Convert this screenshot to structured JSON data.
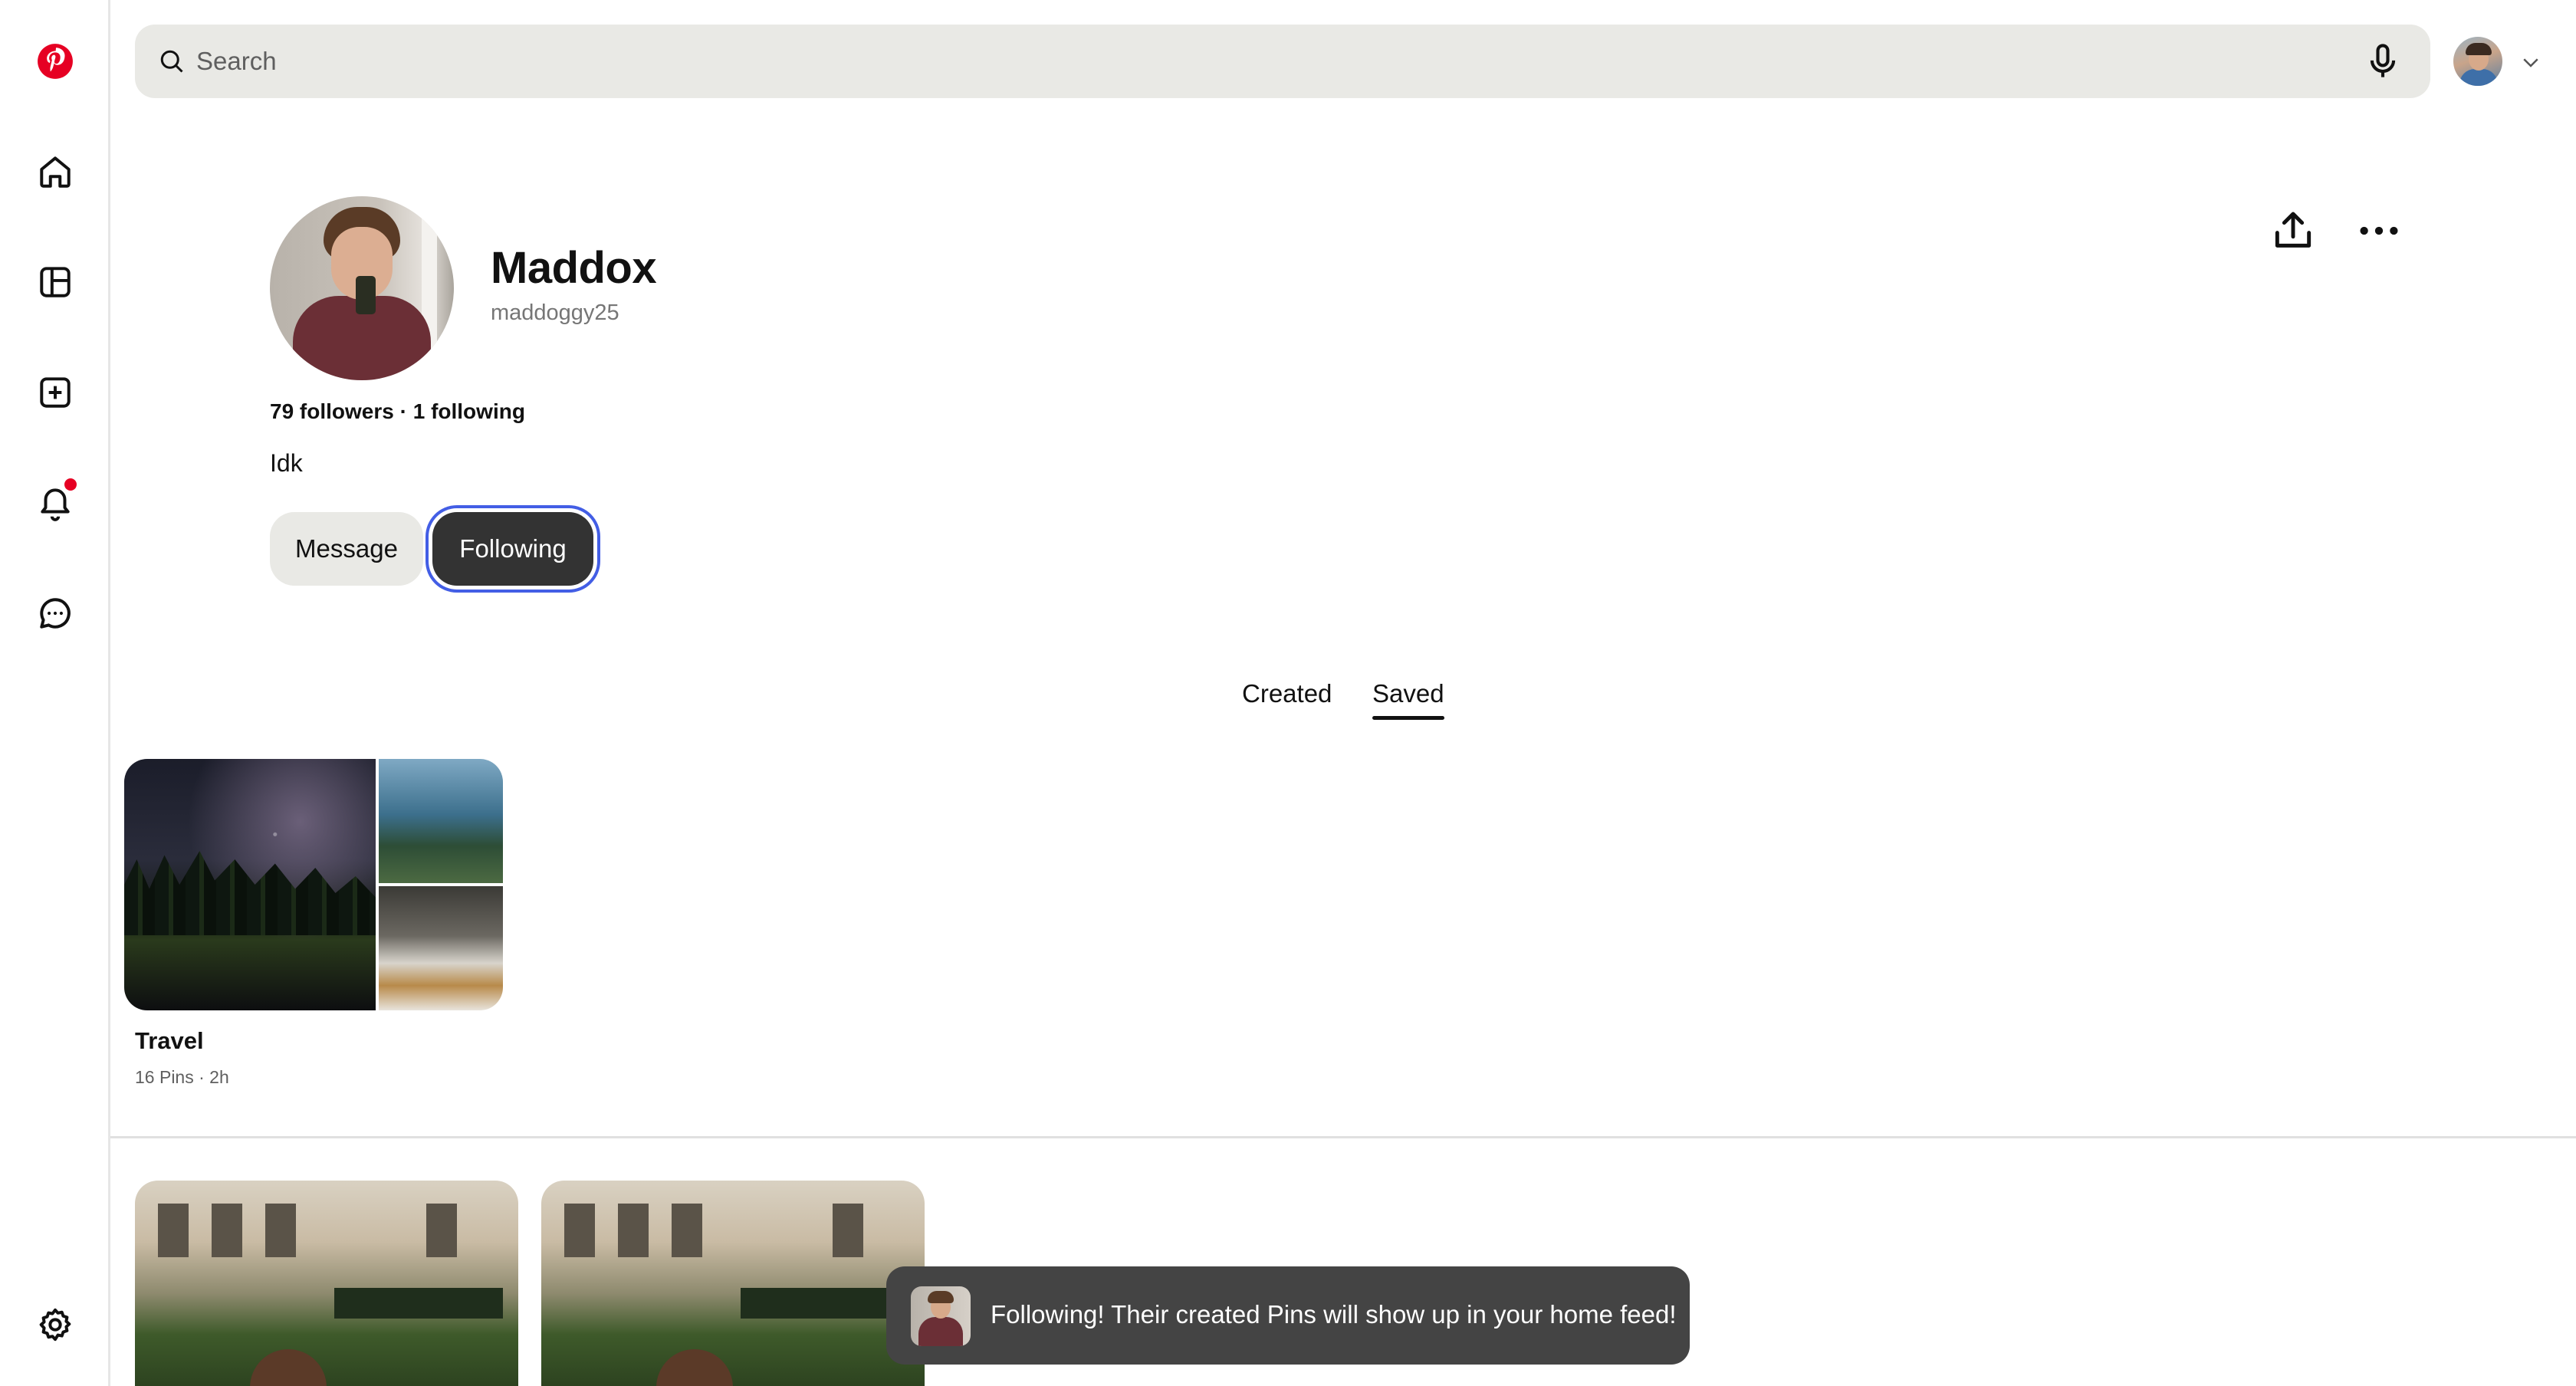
{
  "brand": {
    "logo_color": "#e60023"
  },
  "sidebar": {
    "items": [
      {
        "icon": "home-icon",
        "label": "Home"
      },
      {
        "icon": "boards-icon",
        "label": "Explore"
      },
      {
        "icon": "create-icon",
        "label": "Create"
      },
      {
        "icon": "bell-icon",
        "label": "Notifications",
        "has_badge": true
      },
      {
        "icon": "messages-icon",
        "label": "Messages"
      },
      {
        "icon": "gear-icon",
        "label": "Settings"
      }
    ]
  },
  "search": {
    "placeholder": "Search"
  },
  "profile": {
    "name": "Maddox",
    "handle": "maddoggy25",
    "stats": "79 followers · 1 following",
    "bio": "Idk",
    "message_label": "Message",
    "following_label": "Following"
  },
  "tabs": [
    {
      "label": "Created",
      "active": false
    },
    {
      "label": "Saved",
      "active": true
    }
  ],
  "boards": [
    {
      "title": "Travel",
      "meta": "16 Pins · 2h"
    }
  ],
  "toast": {
    "text": "Following! Their created Pins will show up in your home feed!"
  },
  "colors": {
    "accent": "#e60023",
    "focus_ring": "#435ee5",
    "button_dark": "#333333",
    "button_light": "#e9e9e5"
  }
}
